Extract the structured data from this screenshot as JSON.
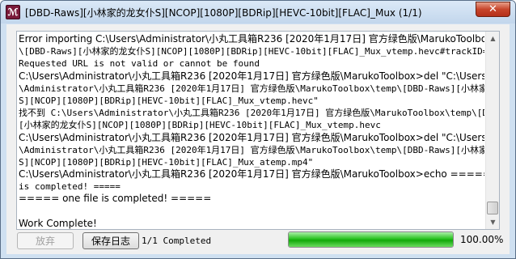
{
  "window": {
    "title": "[DBD-Raws][小林家的龙女仆S][NCOP][1080P][BDRip][HEVC-10bit][FLAC]_Mux (1/1)",
    "icon_glyph": "ℳ",
    "close_glyph": "✕"
  },
  "log": {
    "lines": [
      {
        "text": "Error importing C:\\Users\\Administrator\\小丸工具箱R236 [2020年1月17日] 官方绿色版\\MarukoToolbox\\temp",
        "big": true
      },
      {
        "text": "\\[DBD-Raws][小林家的龙女仆S][NCOP][1080P][BDRip][HEVC-10bit][FLAC]_Mux_vtemp.hevc#trackID=1:name=:",
        "big": false
      },
      {
        "text": "Requested URL is not valid or cannot be found",
        "big": false
      },
      {
        "text": "C:\\Users\\Administrator\\小丸工具箱R236 [2020年1月17日] 官方绿色版\\MarukoToolbox>del \"C:\\Users",
        "big": true
      },
      {
        "text": "\\Administrator\\小丸工具箱R236 [2020年1月17日] 官方绿色版\\MarukoToolbox\\temp\\[DBD-Raws][小林家的龙女仆",
        "big": false
      },
      {
        "text": "S][NCOP][1080P][BDRip][HEVC-10bit][FLAC]_Mux_vtemp.hevc\"",
        "big": false
      },
      {
        "text": "找不到 C:\\Users\\Administrator\\小丸工具箱R236 [2020年1月17日] 官方绿色版\\MarukoToolbox\\temp\\[DBD-Raws]",
        "big": false
      },
      {
        "text": "[小林家的龙女仆S][NCOP][1080P][BDRip][HEVC-10bit][FLAC]_Mux_vtemp.hevc",
        "big": false
      },
      {
        "text": "C:\\Users\\Administrator\\小丸工具箱R236 [2020年1月17日] 官方绿色版\\MarukoToolbox>del \"C:\\Users",
        "big": true
      },
      {
        "text": "\\Administrator\\小丸工具箱R236 [2020年1月17日] 官方绿色版\\MarukoToolbox\\temp\\[DBD-Raws][小林家的龙女仆",
        "big": false
      },
      {
        "text": "S][NCOP][1080P][BDRip][HEVC-10bit][FLAC]_Mux_atemp.mp4\"",
        "big": false
      },
      {
        "text": "C:\\Users\\Administrator\\小丸工具箱R236 [2020年1月17日] 官方绿色版\\MarukoToolbox>echo ===== one file",
        "big": true
      },
      {
        "text": "is completed! =====",
        "big": false
      },
      {
        "text": "===== one file is completed! =====",
        "big": true
      },
      {
        "text": "",
        "big": false
      },
      {
        "text": "Work Complete!",
        "big": true
      }
    ]
  },
  "scrollbar": {
    "up_glyph": "▲",
    "down_glyph": "▼"
  },
  "buttons": {
    "abort_label": "放弃",
    "save_log_label": "保存日志"
  },
  "status": {
    "text": "1/1 Completed"
  },
  "progress": {
    "percent": 100,
    "label": "100.00%"
  }
}
